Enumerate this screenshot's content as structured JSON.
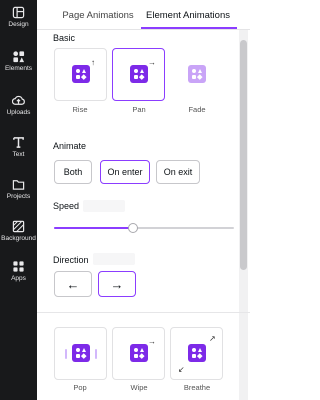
{
  "sidebar": {
    "items": [
      {
        "label": "Design",
        "icon": "design-icon"
      },
      {
        "label": "Elements",
        "icon": "elements-icon"
      },
      {
        "label": "Uploads",
        "icon": "uploads-icon"
      },
      {
        "label": "Text",
        "icon": "text-icon"
      },
      {
        "label": "Projects",
        "icon": "projects-icon"
      },
      {
        "label": "Background",
        "icon": "background-icon"
      },
      {
        "label": "Apps",
        "icon": "apps-icon"
      }
    ]
  },
  "tabs": [
    {
      "label": "Page Animations",
      "active": false
    },
    {
      "label": "Element Animations",
      "active": true
    }
  ],
  "basic": {
    "title": "Basic",
    "tiles": [
      {
        "label": "Rise",
        "selected": false
      },
      {
        "label": "Pan",
        "selected": true
      },
      {
        "label": "Fade",
        "selected": false
      }
    ]
  },
  "animate": {
    "title": "Animate",
    "options": [
      {
        "label": "Both",
        "selected": false
      },
      {
        "label": "On enter",
        "selected": true
      },
      {
        "label": "On exit",
        "selected": false
      }
    ]
  },
  "speed": {
    "title": "Speed",
    "input_value": "",
    "level": 0.44
  },
  "direction": {
    "title": "Direction",
    "input_value": "",
    "left_arrow": "←",
    "right_arrow": "→",
    "selected": "right"
  },
  "more": {
    "tiles": [
      {
        "label": "Pop"
      },
      {
        "label": "Wipe"
      },
      {
        "label": "Breathe"
      }
    ]
  },
  "colors": {
    "accent": "#8b3dff",
    "sidebar_bg": "#18191b",
    "thumb": "#7d2ae8"
  }
}
